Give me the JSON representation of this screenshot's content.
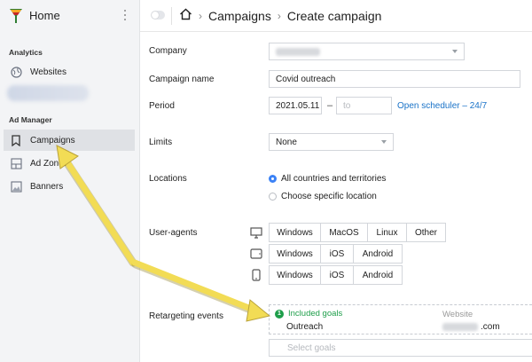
{
  "sidebar": {
    "brand_title": "Home",
    "sections": {
      "analytics": "Analytics",
      "ad_manager": "Ad Manager"
    },
    "items": {
      "websites": "Websites",
      "campaigns": "Campaigns",
      "ad_zones": "Ad Zones",
      "banners": "Banners"
    },
    "active_item": "campaigns"
  },
  "header": {
    "breadcrumb": [
      "Campaigns",
      "Create campaign"
    ]
  },
  "form": {
    "company": {
      "label": "Company"
    },
    "campaign_name": {
      "label": "Campaign name",
      "value": "Covid outreach"
    },
    "period": {
      "label": "Period",
      "start": "2021.05.11",
      "separator": "–",
      "end_placeholder": "to",
      "scheduler_link": "Open scheduler – 24/7"
    },
    "limits": {
      "label": "Limits",
      "value": "None"
    },
    "locations": {
      "label": "Locations",
      "options": [
        "All countries and territories",
        "Choose specific location"
      ],
      "selected": 0
    },
    "user_agents": {
      "label": "User-agents",
      "desktop": [
        "Windows",
        "MacOS",
        "Linux",
        "Other"
      ],
      "tablet": [
        "Windows",
        "iOS",
        "Android"
      ],
      "mobile": [
        "Windows",
        "iOS",
        "Android"
      ]
    },
    "retargeting": {
      "label": "Retargeting events",
      "included_count": "1",
      "included_title": "Included goals",
      "column_website": "Website",
      "goal_name": "Outreach",
      "goal_site_suffix": ".com",
      "select_placeholder": "Select goals"
    }
  },
  "colors": {
    "accent": "#3b82f6",
    "link": "#1a73c8",
    "success": "#1e9e4a",
    "annotation_arrow": "#f2dc55"
  }
}
